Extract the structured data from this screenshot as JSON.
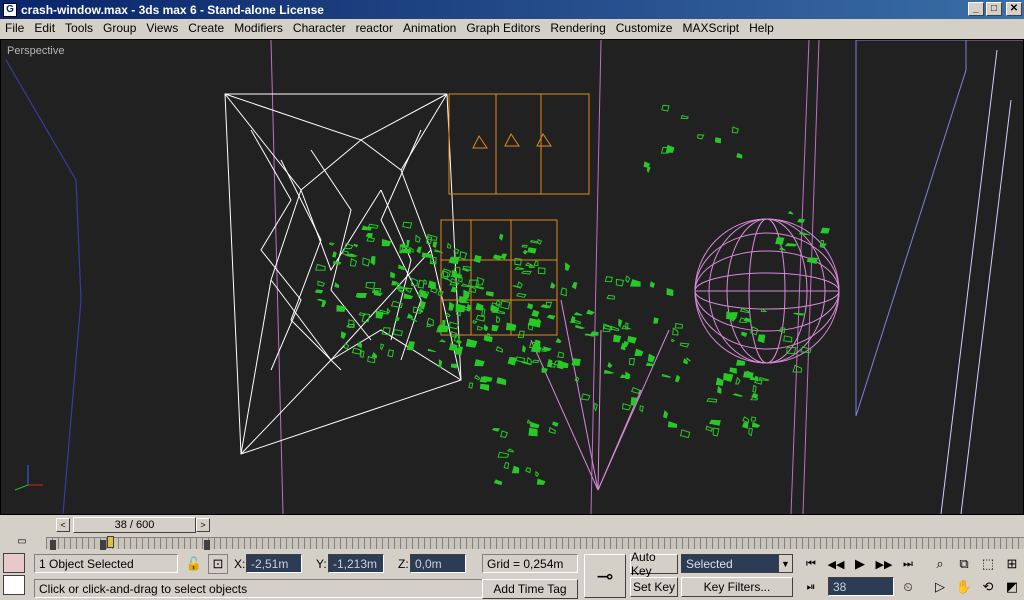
{
  "window": {
    "app_icon": "G",
    "title": "crash-window.max - 3ds max 6 - Stand-alone License",
    "buttons": {
      "minimize": "_",
      "maximize": "□",
      "close": "✕"
    }
  },
  "menu": [
    "File",
    "Edit",
    "Tools",
    "Group",
    "Views",
    "Create",
    "Modifiers",
    "Character",
    "reactor",
    "Animation",
    "Graph Editors",
    "Rendering",
    "Customize",
    "MAXScript",
    "Help"
  ],
  "viewport": {
    "label": "Perspective",
    "colors": {
      "background": "#212121",
      "wire_white": "#ffffff",
      "wire_orange": "#e08a1c",
      "debris_green": "#28c828",
      "wire_pink": "#d88ad8",
      "wire_blue": "#8080e0"
    }
  },
  "timeslider": {
    "frame_label": "38 / 600",
    "prev": "<",
    "next": ">"
  },
  "status": {
    "selection": "1 Object Selected",
    "prompt": "Click or click-and-drag to select objects",
    "coords": {
      "x_label": "X:",
      "x": "-2,51m",
      "y_label": "Y:",
      "y": "-1,213m",
      "z_label": "Z:",
      "z": "0,0m"
    },
    "grid": "Grid = 0,254m",
    "add_time_tag": "Add Time Tag",
    "auto_key": "Auto Key",
    "set_key": "Set Key",
    "key_mode": "Selected",
    "key_filters": "Key Filters...",
    "current_frame": "38",
    "key_icon": "key-icon"
  }
}
